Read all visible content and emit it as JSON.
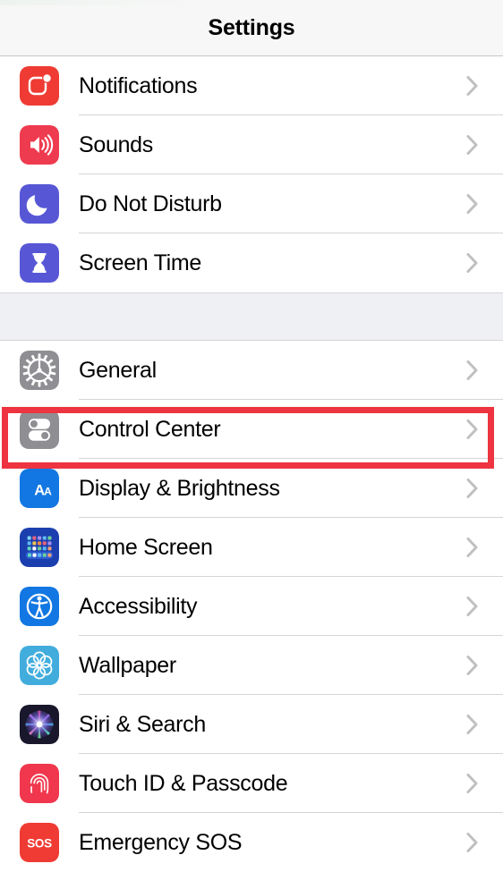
{
  "nav": {
    "title": "Settings"
  },
  "colors": {
    "highlight": "#ed3440",
    "nav_background": "#f7f7f7",
    "group_gap": "#eff0f4",
    "separator": "#d5d5d7",
    "chevron": "#c0c0c2",
    "label": "#000000"
  },
  "groups": [
    {
      "id": "group-1",
      "items": [
        {
          "label": "Notifications",
          "icon": "notifications-icon",
          "icon_color": "#ef3b33",
          "chevron": "chevron-right-icon",
          "highlighted": false
        },
        {
          "label": "Sounds",
          "icon": "sounds-icon",
          "icon_color": "#ef3b4f",
          "chevron": "chevron-right-icon",
          "highlighted": false
        },
        {
          "label": "Do Not Disturb",
          "icon": "do-not-disturb-icon",
          "icon_color": "#5757d6",
          "chevron": "chevron-right-icon",
          "highlighted": false
        },
        {
          "label": "Screen Time",
          "icon": "screen-time-icon",
          "icon_color": "#5757d6",
          "chevron": "chevron-right-icon",
          "highlighted": false
        }
      ]
    },
    {
      "id": "group-2",
      "items": [
        {
          "label": "General",
          "icon": "general-gear-icon",
          "icon_color": "#8e8e93",
          "chevron": "chevron-right-icon",
          "highlighted": false
        },
        {
          "label": "Control Center",
          "icon": "control-center-icon",
          "icon_color": "#8e8e93",
          "chevron": "chevron-right-icon",
          "highlighted": true
        },
        {
          "label": "Display & Brightness",
          "icon": "display-brightness-icon",
          "icon_color": "#1277e2",
          "chevron": "chevron-right-icon",
          "highlighted": false
        },
        {
          "label": "Home Screen",
          "icon": "home-screen-icon",
          "icon_color": "#1b3fae",
          "chevron": "chevron-right-icon",
          "highlighted": false
        },
        {
          "label": "Accessibility",
          "icon": "accessibility-icon",
          "icon_color": "#1277e2",
          "chevron": "chevron-right-icon",
          "highlighted": false
        },
        {
          "label": "Wallpaper",
          "icon": "wallpaper-icon",
          "icon_color": "#42addd",
          "chevron": "chevron-right-icon",
          "highlighted": false
        },
        {
          "label": "Siri & Search",
          "icon": "siri-search-icon",
          "icon_color": "#18172b",
          "chevron": "chevron-right-icon",
          "highlighted": false
        },
        {
          "label": "Touch ID & Passcode",
          "icon": "touch-id-passcode-icon",
          "icon_color": "#f0374d",
          "chevron": "chevron-right-icon",
          "highlighted": false
        },
        {
          "label": "Emergency SOS",
          "icon": "emergency-sos-icon",
          "icon_color": "#ef3b33",
          "chevron": "chevron-right-icon",
          "highlighted": false
        }
      ]
    }
  ],
  "icon_glyph_text": {
    "display_brightness": "AA",
    "emergency_sos": "SOS"
  }
}
